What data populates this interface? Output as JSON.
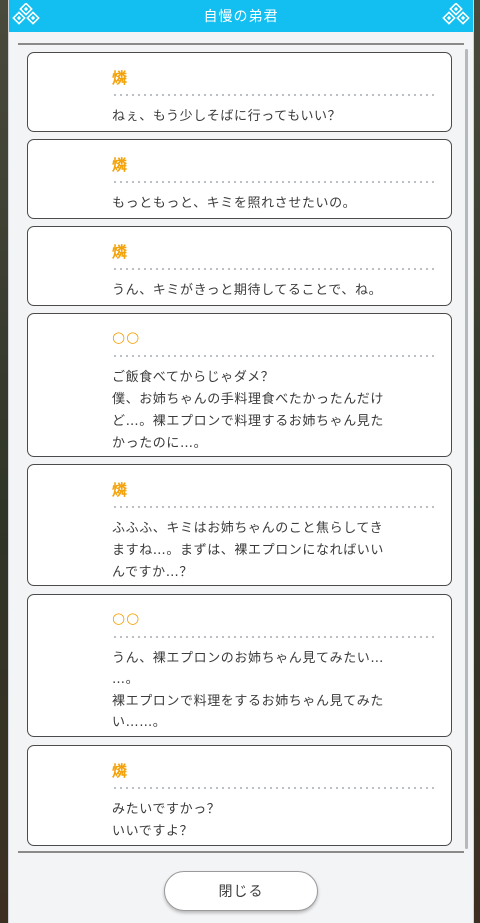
{
  "window": {
    "title": "自慢の弟君"
  },
  "log": [
    {
      "speaker": "燐",
      "lines": [
        "ねぇ、もう少しそばに行ってもいい？"
      ]
    },
    {
      "speaker": "燐",
      "lines": [
        "もっともっと、キミを照れさせたいの。"
      ]
    },
    {
      "speaker": "燐",
      "lines": [
        "うん、キミがきっと期待してることで、ね。"
      ]
    },
    {
      "speaker": "○○",
      "lines": [
        "ご飯食べてからじゃダメ？",
        "僕、お姉ちゃんの手料理食べたかったんだけ",
        "ど…。裸エプロンで料理するお姉ちゃん見た",
        "かったのに…。"
      ]
    },
    {
      "speaker": "燐",
      "lines": [
        "ふふふ、キミはお姉ちゃんのこと焦らしてき",
        "ますね…。まずは、裸エプロンになればいい",
        "んですか…？"
      ]
    },
    {
      "speaker": "○○",
      "lines": [
        "うん、裸エプロンのお姉ちゃん見てみたい…",
        "…。",
        "裸エプロンで料理をするお姉ちゃん見てみた",
        "い……。"
      ]
    },
    {
      "speaker": "燐",
      "lines": [
        "みたいですかっ？",
        "いいですよ？"
      ]
    }
  ],
  "footer": {
    "close_label": "閉じる"
  },
  "icons": {
    "title_left": "diamond-ornament-icon",
    "title_right": "diamond-ornament-icon"
  },
  "colors": {
    "title_bar": "#12bff0",
    "speaker_name": "#f3a30c",
    "text": "#3b3b3b"
  }
}
